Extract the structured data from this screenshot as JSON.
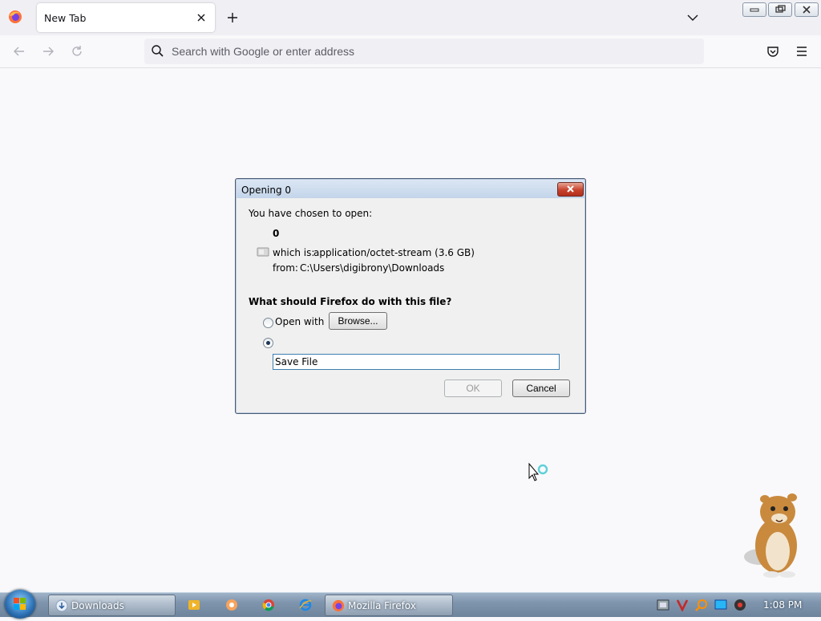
{
  "browser": {
    "tab_title": "New Tab",
    "url_placeholder": "Search with Google or enter address"
  },
  "dialog": {
    "title": "Opening 0",
    "intro": "You have chosen to open:",
    "file_name": "0",
    "which_is_label": "which is:",
    "which_is_value": "application/octet-stream (3.6 GB)",
    "from_label": "from:",
    "from_value": "C:\\Users\\digibrony\\Downloads",
    "question": "What should Firefox do with this file?",
    "open_with_label": "Open with",
    "browse_label": "Browse...",
    "save_file_label": "Save File",
    "selected_option": "Save File",
    "ok_label": "OK",
    "cancel_label": "Cancel"
  },
  "taskbar": {
    "items": [
      {
        "label": "Downloads",
        "icon": "downloads-window-icon"
      },
      {
        "label": "Mozilla Firefox",
        "icon": "firefox-icon"
      }
    ],
    "pinned": [
      "media-player-icon",
      "app-icon",
      "chrome-icon",
      "internet-explorer-icon"
    ],
    "tray": [
      "network-icon",
      "v-icon",
      "search-icon",
      "display-icon",
      "speaker-icon"
    ],
    "clock": "1:08 PM"
  },
  "colors": {
    "accent": "#3c7fb1",
    "close_red": "#c7432d"
  }
}
